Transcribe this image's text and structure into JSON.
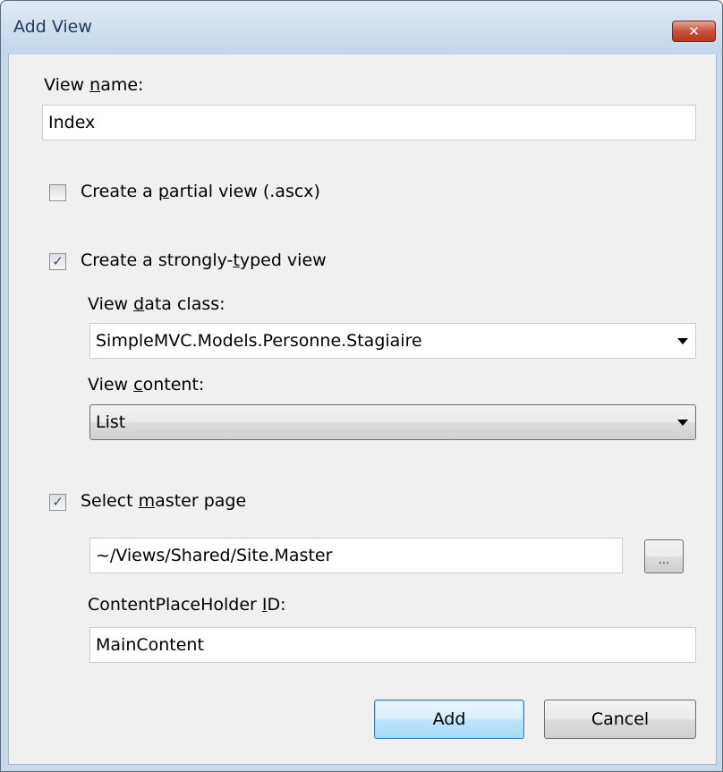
{
  "dialog": {
    "title": "Add View",
    "close_glyph": "✕"
  },
  "view_name": {
    "label_pre": "View ",
    "label_accel": "n",
    "label_post": "ame:",
    "value": "Index"
  },
  "partial_view": {
    "label_pre": "Create a ",
    "label_accel": "p",
    "label_post": "artial view (.ascx)",
    "checked": false
  },
  "strongly_typed": {
    "label_pre": "Create a strongly-",
    "label_accel": "t",
    "label_post": "yped view",
    "checked": true,
    "check_glyph": "✓"
  },
  "view_data_class": {
    "label_pre": "View ",
    "label_accel": "d",
    "label_post": "ata class:",
    "value": "SimpleMVC.Models.Personne.Stagiaire"
  },
  "view_content": {
    "label_pre": "View ",
    "label_accel": "c",
    "label_post": "ontent:",
    "value": "List"
  },
  "master_page": {
    "label_pre": "Select ",
    "label_accel": "m",
    "label_post": "aster page",
    "checked": true,
    "check_glyph": "✓",
    "path": "~/Views/Shared/Site.Master",
    "browse_label": "..."
  },
  "content_placeholder": {
    "label_pre": "ContentPlaceHolder ",
    "label_accel": "I",
    "label_post": "D:",
    "value": "MainContent"
  },
  "buttons": {
    "add": "Add",
    "cancel": "Cancel"
  },
  "colors": {
    "title_text": "#1e395b",
    "frame": "#c9d9ec",
    "client_bg": "#f0f0f0",
    "close_button": "#c9503b",
    "default_button": "#bee6fd"
  }
}
